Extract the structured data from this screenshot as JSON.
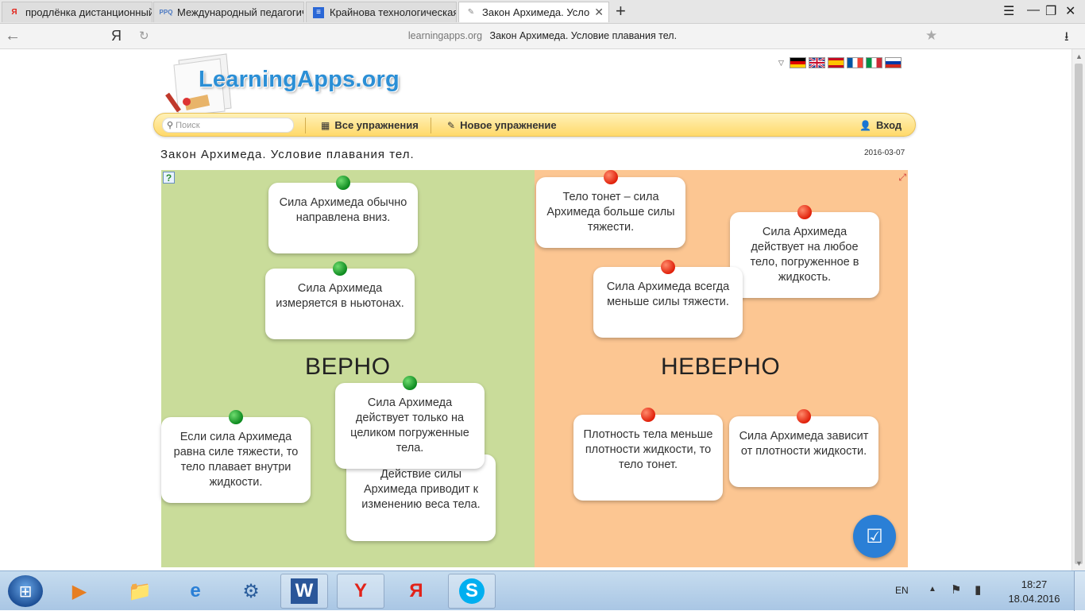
{
  "browser": {
    "tabs": [
      {
        "label": "продлёнка дистанционный с",
        "icon": "Я",
        "icon_color": "#e2231a"
      },
      {
        "label": "Международный педагогиче",
        "icon": "PPQ",
        "icon_color": "#4a78c2"
      },
      {
        "label": "Крайнова технологическая к",
        "icon": "≡",
        "icon_color": "#2a67d6"
      },
      {
        "label": "Закон Архимеда. Услови",
        "icon": "✎",
        "icon_color": "#888"
      }
    ],
    "new_tab": "+",
    "yandex_label": "Я",
    "url_domain": "learningapps.org",
    "url_title": "Закон Архимеда. Условие плавания тел."
  },
  "site": {
    "logo": "LearningApps.org",
    "search_placeholder": "Поиск",
    "nav": {
      "all_exercises": "Все упражнения",
      "new_exercise": "Новое упражнение",
      "login": "Вход"
    },
    "languages": [
      "de",
      "en",
      "es",
      "fr",
      "it",
      "ru"
    ]
  },
  "exercise": {
    "title": "Закон Архимеда. Условие плавания тел.",
    "date": "2016-03-07",
    "zone_true": "ВЕРНО",
    "zone_false": "НЕВЕРНО",
    "cards": [
      {
        "text": "Сила Архимеда обычно направлена вниз.",
        "pin": "green"
      },
      {
        "text": "Сила Архимеда измеряется в ньютонах.",
        "pin": "green"
      },
      {
        "text": "Если сила Архимеда равна силе тяжести, то тело плавает внутри жидкости.",
        "pin": "green"
      },
      {
        "text": "Сила Архимеда действует только на целиком погруженные тела.",
        "pin": "green"
      },
      {
        "text": "Действие силы Архимеда приводит к изменению веса тела.",
        "pin": "none"
      },
      {
        "text": "Тело тонет – сила Архимеда больше силы тяжести.",
        "pin": "red"
      },
      {
        "text": "Сила Архимеда действует на любое тело, погруженное в жидкость.",
        "pin": "red"
      },
      {
        "text": "Сила Архимеда всегда меньше силы тяжести.",
        "pin": "red"
      },
      {
        "text": "Плотность тела меньше плотности жидкости, то тело тонет.",
        "pin": "red"
      },
      {
        "text": "Сила Архимеда зависит от плотности жидкости.",
        "pin": "red"
      }
    ],
    "colors": {
      "true_zone": "#c9dc9a",
      "false_zone": "#fcc692",
      "check_button": "#2a7fd6"
    }
  },
  "taskbar": {
    "language": "EN",
    "time": "18:27",
    "date": "18.04.2016"
  }
}
